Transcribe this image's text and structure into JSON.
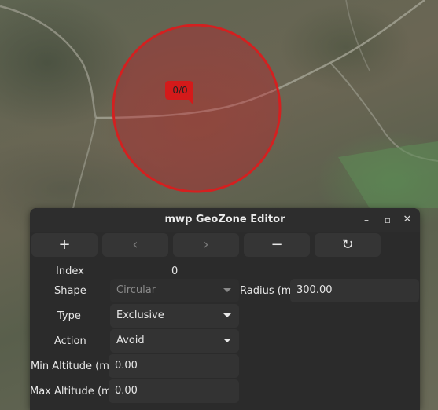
{
  "map": {
    "zone_marker_label": "0/0",
    "zone_color": "#d42020"
  },
  "window": {
    "title": "mwp GeoZone Editor",
    "controls": {
      "minimize": "–",
      "maximize": "▫",
      "close": "✕"
    }
  },
  "toolbar": {
    "add_icon": "+",
    "prev_icon": "‹",
    "next_icon": "›",
    "remove_icon": "−",
    "refresh_icon": "↻"
  },
  "form": {
    "index": {
      "label": "Index",
      "value": "0"
    },
    "shape": {
      "label": "Shape",
      "value": "Circular"
    },
    "radius": {
      "label": "Radius (m)",
      "value": "300.00"
    },
    "type": {
      "label": "Type",
      "value": "Exclusive"
    },
    "action": {
      "label": "Action",
      "value": "Avoid"
    },
    "min_alt": {
      "label": "Min Altitude (m)",
      "value": "0.00"
    },
    "max_alt": {
      "label": "Max Altitude (m)",
      "value": "0.00"
    }
  }
}
